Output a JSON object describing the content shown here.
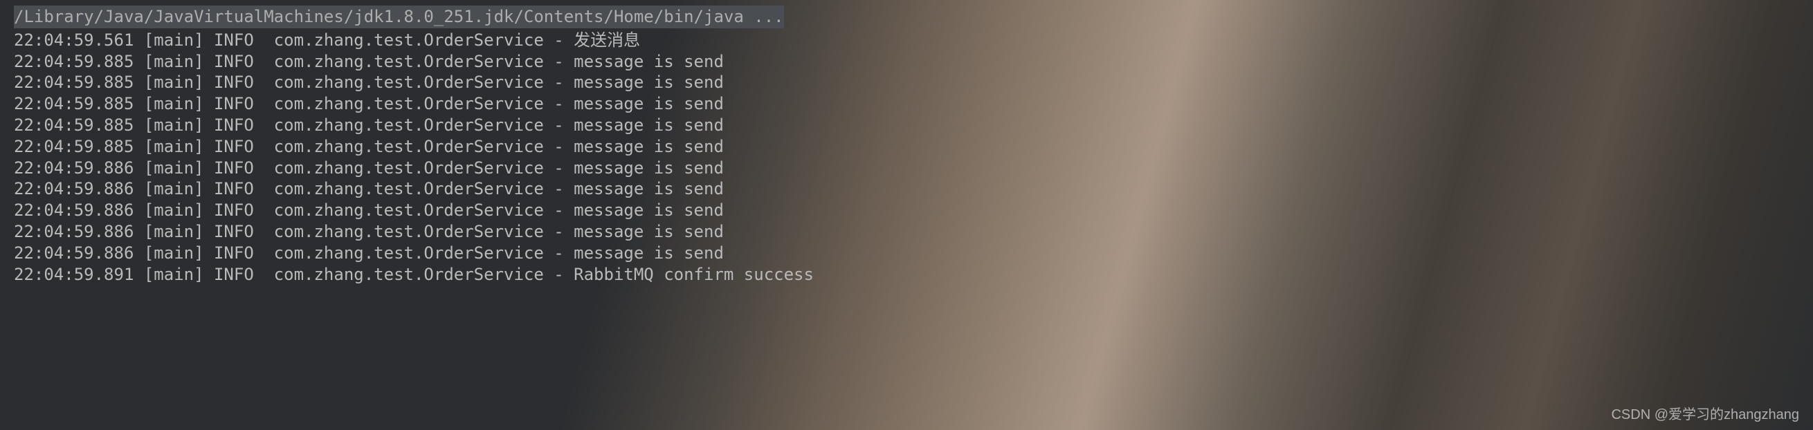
{
  "header": "/Library/Java/JavaVirtualMachines/jdk1.8.0_251.jdk/Contents/Home/bin/java ...",
  "logs": [
    {
      "time": "22:04:59.561",
      "thread": "[main]",
      "level": "INFO",
      "logger": "com.zhang.test.OrderService",
      "sep": "-",
      "msg": "发送消息"
    },
    {
      "time": "22:04:59.885",
      "thread": "[main]",
      "level": "INFO",
      "logger": "com.zhang.test.OrderService",
      "sep": "-",
      "msg": "message is send"
    },
    {
      "time": "22:04:59.885",
      "thread": "[main]",
      "level": "INFO",
      "logger": "com.zhang.test.OrderService",
      "sep": "-",
      "msg": "message is send"
    },
    {
      "time": "22:04:59.885",
      "thread": "[main]",
      "level": "INFO",
      "logger": "com.zhang.test.OrderService",
      "sep": "-",
      "msg": "message is send"
    },
    {
      "time": "22:04:59.885",
      "thread": "[main]",
      "level": "INFO",
      "logger": "com.zhang.test.OrderService",
      "sep": "-",
      "msg": "message is send"
    },
    {
      "time": "22:04:59.885",
      "thread": "[main]",
      "level": "INFO",
      "logger": "com.zhang.test.OrderService",
      "sep": "-",
      "msg": "message is send"
    },
    {
      "time": "22:04:59.886",
      "thread": "[main]",
      "level": "INFO",
      "logger": "com.zhang.test.OrderService",
      "sep": "-",
      "msg": "message is send"
    },
    {
      "time": "22:04:59.886",
      "thread": "[main]",
      "level": "INFO",
      "logger": "com.zhang.test.OrderService",
      "sep": "-",
      "msg": "message is send"
    },
    {
      "time": "22:04:59.886",
      "thread": "[main]",
      "level": "INFO",
      "logger": "com.zhang.test.OrderService",
      "sep": "-",
      "msg": "message is send"
    },
    {
      "time": "22:04:59.886",
      "thread": "[main]",
      "level": "INFO",
      "logger": "com.zhang.test.OrderService",
      "sep": "-",
      "msg": "message is send"
    },
    {
      "time": "22:04:59.886",
      "thread": "[main]",
      "level": "INFO",
      "logger": "com.zhang.test.OrderService",
      "sep": "-",
      "msg": "message is send"
    },
    {
      "time": "22:04:59.891",
      "thread": "[main]",
      "level": "INFO",
      "logger": "com.zhang.test.OrderService",
      "sep": "-",
      "msg": "RabbitMQ confirm success"
    }
  ],
  "watermark": "CSDN @爱学习的zhangzhang"
}
